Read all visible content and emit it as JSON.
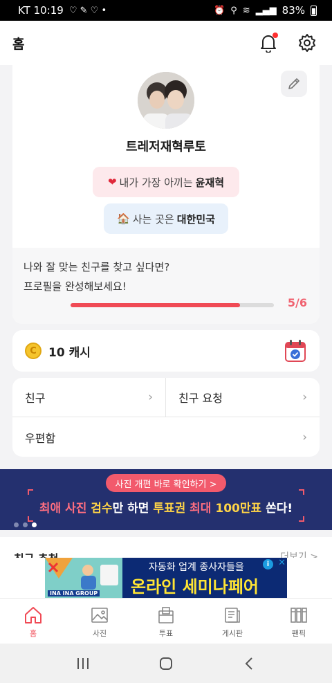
{
  "status_bar": {
    "carrier_time": "KT 10:19",
    "battery_text": "83%"
  },
  "header": {
    "title": "홈"
  },
  "profile": {
    "nickname": "트레저재혁루토",
    "favorite_prefix": "내가 가장 아끼는",
    "favorite_name": "윤재혁",
    "home_prefix": "사는 곳은",
    "home_value": "대한민국",
    "completion_line1": "나와 잘 맞는 친구를 찾고 싶다면?",
    "completion_line2": "프로필을 완성해보세요!",
    "progress_count": "5/6",
    "progress_fraction": 0.833
  },
  "cash": {
    "label": "10 캐시"
  },
  "menu": {
    "friends": "친구",
    "friend_requests": "친구 요청",
    "mailbox": "우편함"
  },
  "banner": {
    "pill": "사진 개편 바로 확인하기 >",
    "headline_part1": "최애 사진",
    "headline_part2": "검수",
    "headline_part3": "만 하면",
    "headline_part4": "투표권",
    "headline_part5": "최대",
    "headline_part6": "100만표",
    "headline_part7": "쏜다!"
  },
  "section_peek": {
    "title": "친구 추천",
    "more": "더보기 >"
  },
  "ad": {
    "brand": "INA INA GROUP",
    "subtitle": "자동화 업계 종사자들을",
    "headline": "온라인 세미나페어"
  },
  "bottom_nav": {
    "home": "홈",
    "photos": "사진",
    "vote": "투표",
    "board": "게시판",
    "fanpick": "팬픽"
  },
  "colors": {
    "accent": "#f04a55",
    "banner_bg": "#24306f",
    "fav_chip": "#fde9ec",
    "home_chip": "#e8f1fb"
  }
}
